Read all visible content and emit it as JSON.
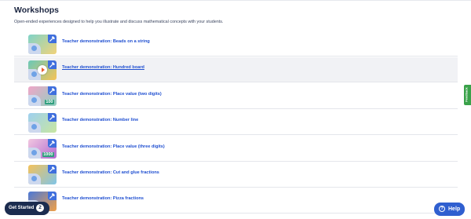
{
  "page": {
    "title": "Workshops",
    "subtitle": "Open-ended experiences designed to help you illustrate and discuss mathematical concepts with your students."
  },
  "workshops": [
    {
      "label": "Teacher demonstration: Beads on a string",
      "thumb_colors": [
        "#7fd3c8",
        "#f2d37a"
      ],
      "thumb_icon": "beads-icon",
      "highlighted": false
    },
    {
      "label": "Teacher demonstration: Hundred board",
      "thumb_colors": [
        "#6ac8b8",
        "#f6c456"
      ],
      "thumb_icon": "play-icon",
      "highlighted": true
    },
    {
      "label": "Teacher demonstration: Place value (two digits)",
      "thumb_colors": [
        "#f0a6c8",
        "#8ed0c0"
      ],
      "thumb_icon": "place-value-icon",
      "thumb_number": "100",
      "highlighted": false
    },
    {
      "label": "Teacher demonstration: Number line",
      "thumb_colors": [
        "#9ed0f0",
        "#c8e6a0"
      ],
      "thumb_icon": "number-line-icon",
      "highlighted": false
    },
    {
      "label": "Teacher demonstration: Place value (three digits)",
      "thumb_colors": [
        "#f2c7e0",
        "#b06ad0"
      ],
      "thumb_icon": "place-value-icon",
      "thumb_number": "1000",
      "highlighted": false
    },
    {
      "label": "Teacher demonstration: Cut and glue fractions",
      "thumb_colors": [
        "#f4c25a",
        "#7fc4e8"
      ],
      "thumb_icon": "fractions-icon",
      "highlighted": false
    },
    {
      "label": "Teacher demonstration: Pizza fractions",
      "thumb_colors": [
        "#4a78d8",
        "#f0a048"
      ],
      "thumb_icon": "pizza-icon",
      "highlighted": false
    }
  ],
  "feedback_tab": {
    "label": "Feedback",
    "color": "#3aa24a"
  },
  "get_started": {
    "label": "Get Started",
    "count": "2",
    "color": "#1b2c4f"
  },
  "help": {
    "label": "Help",
    "icon": "question-icon",
    "color": "#2f5fd0"
  },
  "colors": {
    "link": "#1f4fd1",
    "badge": "#3f6fdd"
  }
}
